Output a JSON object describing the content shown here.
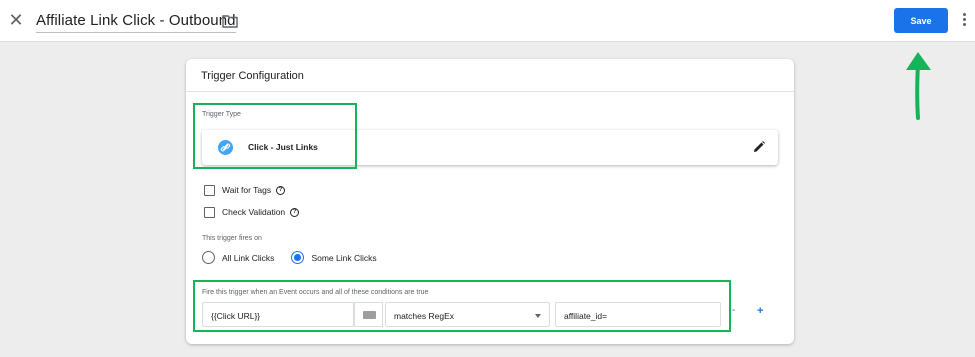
{
  "header": {
    "title": "Affiliate Link Click - Outbound",
    "save_label": "Save",
    "close_icon": "close-icon",
    "folder_icon": "folder-icon",
    "more_icon": "more-vert-icon"
  },
  "card": {
    "heading": "Trigger Configuration",
    "trigger_type_label": "Trigger Type",
    "trigger_type_value": "Click - Just Links",
    "options": {
      "wait_for_tags": "Wait for Tags",
      "check_validation": "Check Validation"
    },
    "fires_on_label": "This trigger fires on",
    "fires_on_options": [
      "All Link Clicks",
      "Some Link Clicks"
    ],
    "fires_on_selected": "Some Link Clicks",
    "condition_label": "Fire this trigger when an Event occurs and all of these conditions are true",
    "condition": {
      "variable": "{{Click URL}}",
      "operator": "matches RegEx",
      "value": "affiliate_id="
    },
    "remove_label": "-",
    "add_label": "+"
  },
  "colors": {
    "accent": "#1a73e8",
    "highlight": "#16b35a",
    "link_icon": "#42a5f5"
  }
}
